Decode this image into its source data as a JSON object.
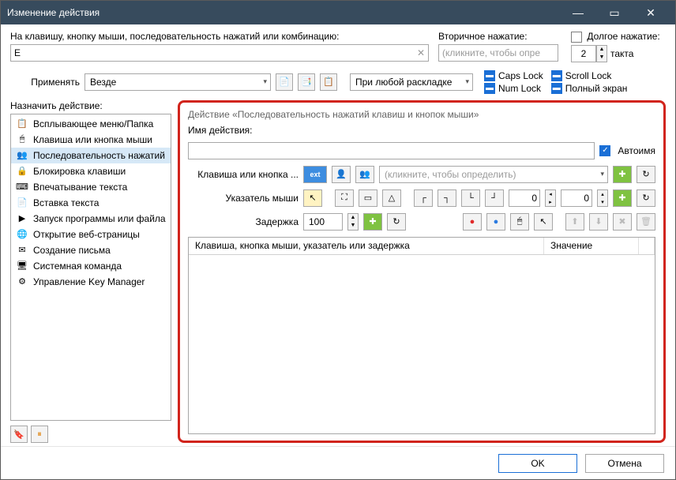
{
  "window": {
    "title": "Изменение действия"
  },
  "top": {
    "hotkey_label": "На клавишу, кнопку мыши, последовательность нажатий или комбинацию:",
    "hotkey_value": "E",
    "secondary_label": "Вторичное нажатие:",
    "secondary_placeholder": "(кликните, чтобы опре",
    "long_label": "Долгое нажатие:",
    "long_value": "2",
    "long_units": "такта"
  },
  "apply": {
    "label": "Применять",
    "scope": "Везде",
    "layout_combo": "При любой раскладке"
  },
  "flags": {
    "caps": "Caps Lock",
    "num": "Num Lock",
    "scroll": "Scroll Lock",
    "full": "Полный экран"
  },
  "assign_label": "Назначить действие:",
  "actions": [
    "Всплывающее меню/Папка",
    "Клавиша или кнопка мыши",
    "Последовательность нажатий",
    "Блокировка клавиши",
    "Впечатывание текста",
    "Вставка текста",
    "Запуск программы или файла",
    "Открытие веб-страницы",
    "Создание письма",
    "Системная команда",
    "Управление Key Manager"
  ],
  "action_icons": [
    "📋",
    "🖱",
    "👥",
    "🔒",
    "⌨",
    "📄",
    "▶",
    "🌐",
    "✉",
    "🖥",
    "⚙"
  ],
  "panel": {
    "title": "Действие «Последовательность нажатий клавиш и кнопок мыши»",
    "name_label": "Имя действия:",
    "autoname": "Автоимя",
    "key_label": "Клавиша или кнопка ...",
    "key_placeholder": "(кликните, чтобы определить)",
    "pointer_label": "Указатель мыши",
    "coord_x": "0",
    "coord_y": "0",
    "delay_label": "Задержка",
    "delay_value": "100",
    "grid_col1": "Клавиша, кнопка мыши, указатель или задержка",
    "grid_col2": "Значение"
  },
  "footer": {
    "ok": "OK",
    "cancel": "Отмена"
  }
}
